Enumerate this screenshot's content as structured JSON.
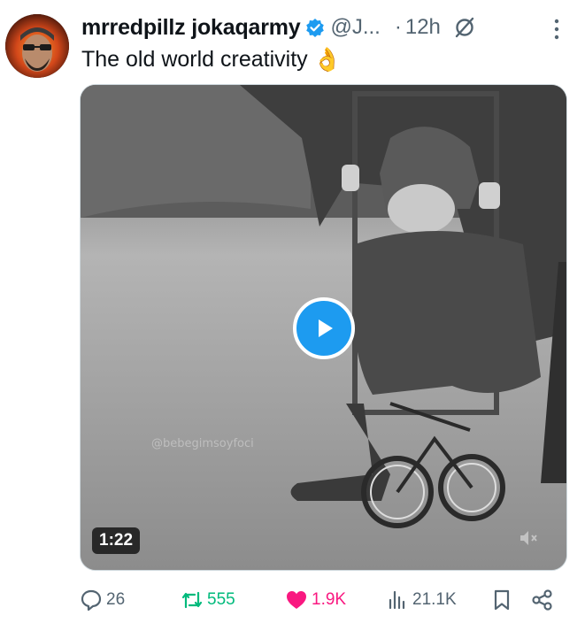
{
  "post": {
    "display_name": "mrredpillz jokaqarmy",
    "handle": "@J...",
    "separator": "·",
    "time": "12h",
    "text": "The old world creativity",
    "emoji": "👌"
  },
  "media": {
    "duration": "1:22",
    "watermark": "@bebegimsoyfoci"
  },
  "actions": {
    "replies": "26",
    "reposts": "555",
    "likes": "1.9K",
    "views": "21.1K"
  },
  "colors": {
    "accent": "#1d9bf0",
    "repost": "#00ba7c",
    "like": "#f91880",
    "secondary": "#536471"
  },
  "icons": [
    "verified-badge-icon",
    "grok-icon",
    "more-icon",
    "play-icon",
    "mute-icon",
    "reply-icon",
    "repost-icon",
    "like-icon",
    "views-icon",
    "bookmark-icon",
    "share-icon"
  ]
}
